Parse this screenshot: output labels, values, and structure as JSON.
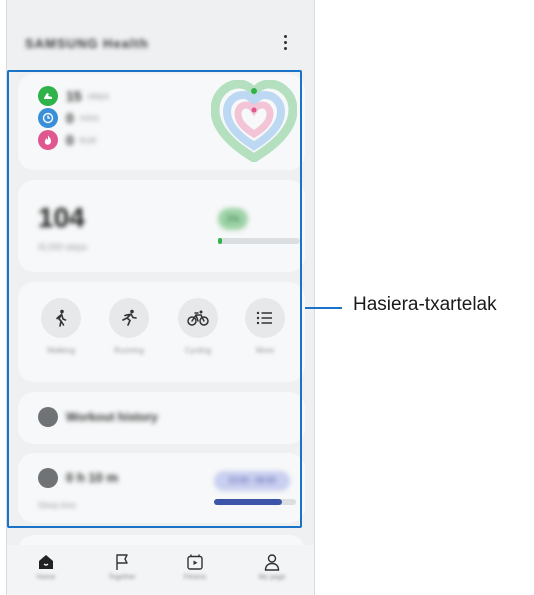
{
  "app": {
    "title": "SAMSUNG Health"
  },
  "activity": {
    "steps": {
      "value": "15",
      "unit": "steps"
    },
    "active_time": {
      "value": "0",
      "unit": "mins"
    },
    "calories": {
      "value": "0",
      "unit": "kcal"
    },
    "colors": {
      "steps": "#2fb24a",
      "time": "#3a8fd9",
      "calories": "#e0578f"
    }
  },
  "steps_card": {
    "value": "104",
    "goal": "/6,000 steps",
    "badge": "2%",
    "progress": 0.02
  },
  "exercise": {
    "items": [
      {
        "icon": "walking-icon",
        "label": "Walking"
      },
      {
        "icon": "running-icon",
        "label": "Running"
      },
      {
        "icon": "cycling-icon",
        "label": "Cycling"
      },
      {
        "icon": "list-icon",
        "label": "More"
      }
    ]
  },
  "history": {
    "label": "Workout history"
  },
  "sleep": {
    "value": "0 h 10 m",
    "subtitle": "Sleep time",
    "badge": "22:00 - 06:00",
    "progress": 0.83
  },
  "bottom_nav": [
    {
      "icon": "home-icon",
      "label": "Home"
    },
    {
      "icon": "flag-icon",
      "label": "Together"
    },
    {
      "icon": "fitness-icon",
      "label": "Fitness"
    },
    {
      "icon": "person-icon",
      "label": "My page"
    }
  ],
  "callout": {
    "label": "Hasiera-txartelak",
    "color": "#1a73c8"
  }
}
